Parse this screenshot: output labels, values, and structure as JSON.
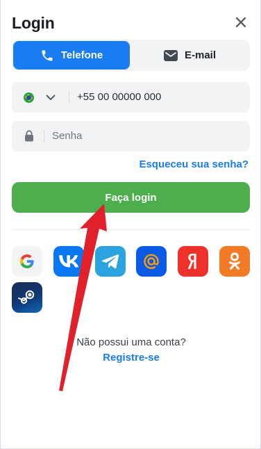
{
  "header": {
    "title": "Login",
    "close_icon": "close-icon"
  },
  "tabs": [
    {
      "label": "Telefone",
      "icon": "phone-icon",
      "active": true
    },
    {
      "label": "E-mail",
      "icon": "mail-icon",
      "active": false
    }
  ],
  "phone_field": {
    "country_flag": "brazil-flag-icon",
    "value": "+55 00 00000 000"
  },
  "password_field": {
    "placeholder": "Senha",
    "icon": "lock-icon"
  },
  "forgot_link": "Esqueceu sua senha?",
  "login_button": "Faça login",
  "social_logins": [
    "google",
    "vk",
    "telegram",
    "mail-ru",
    "yandex",
    "odnoklassniki",
    "steam"
  ],
  "signup": {
    "prompt": "Não possui uma conta?",
    "link": "Registre-se"
  },
  "colors": {
    "primary": "#1a7cf2",
    "success": "#4cae4c",
    "annotation_arrow": "#e0212b"
  }
}
